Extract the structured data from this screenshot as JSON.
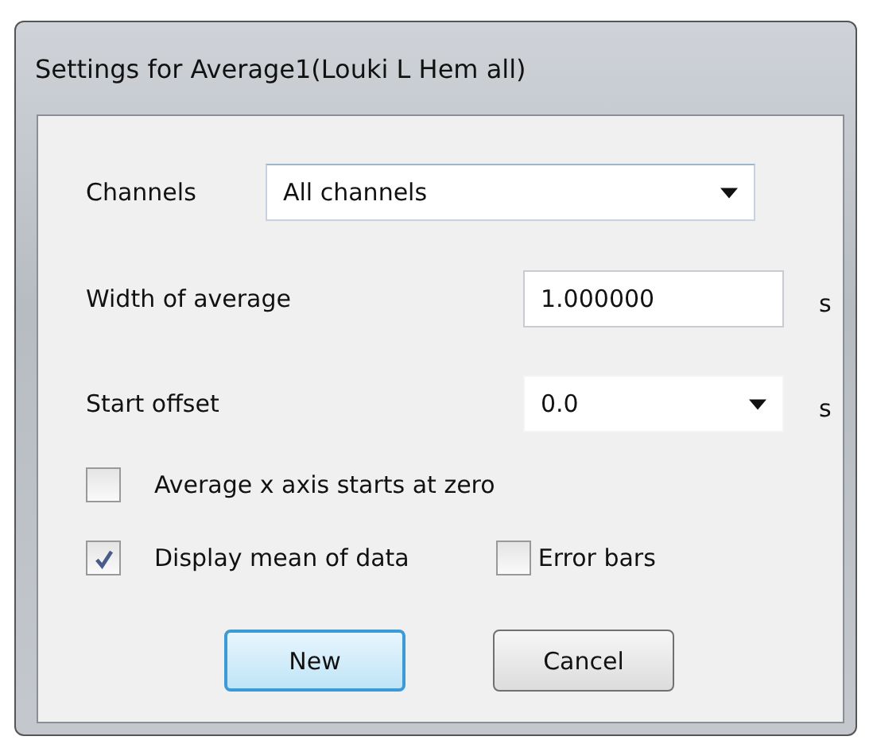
{
  "window": {
    "title": "Settings for Average1(Louki L Hem all)"
  },
  "fields": [
    {
      "kind": "dropdown",
      "label": "Channels",
      "value": "All channels"
    },
    {
      "kind": "text",
      "label": "Width of average",
      "value": "1.000000",
      "unit": "s"
    },
    {
      "kind": "combo",
      "label": "Start offset",
      "value": "0.0",
      "unit": "s"
    }
  ],
  "checkbox_rows": [
    [
      {
        "label": "Average x axis starts at zero",
        "checked": false
      }
    ],
    [
      {
        "label": "Display mean of data",
        "checked": true
      },
      {
        "label": "Error bars",
        "checked": false
      }
    ]
  ],
  "buttons": [
    {
      "label": "New",
      "default": true
    },
    {
      "label": "Cancel",
      "default": false
    }
  ]
}
